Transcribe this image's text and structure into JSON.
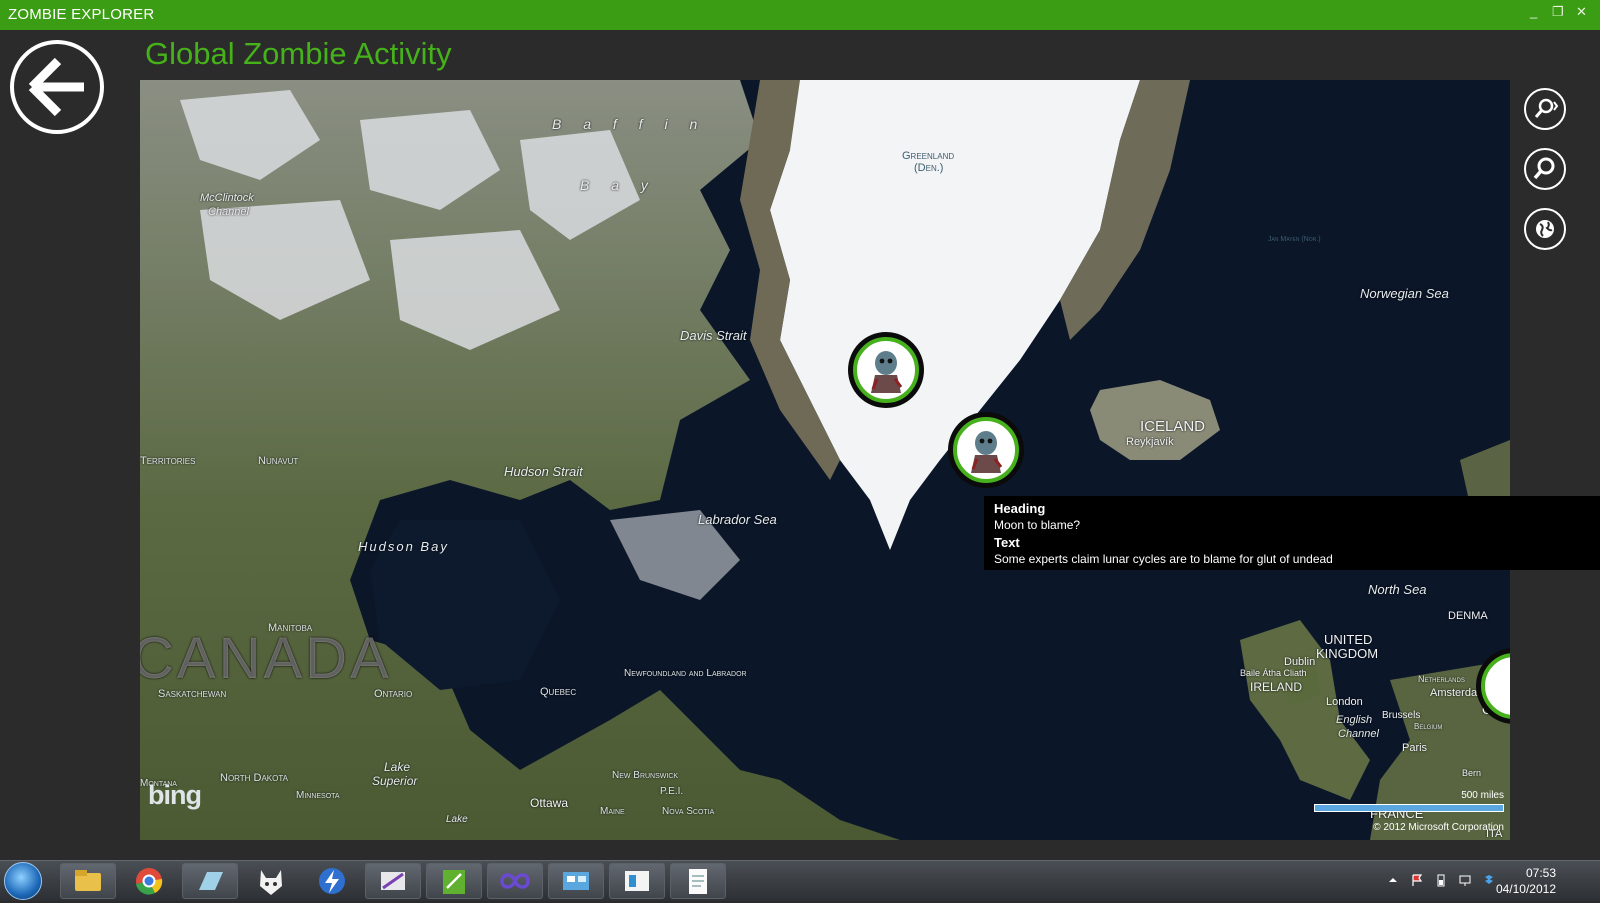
{
  "window": {
    "title": "ZOMBIE EXPLORER",
    "minimize": "_",
    "restore": "❐",
    "close": "✕"
  },
  "page": {
    "title": "Global Zombie Activity"
  },
  "map": {
    "labels": {
      "baffin_bay_1": "B a f f i n",
      "baffin_bay_2": "B a y",
      "mcclintock_1": "McClintock",
      "mcclintock_2": "Channel",
      "greenland_1": "Greenland",
      "greenland_2": "(Den.)",
      "davis_strait": "Davis Strait",
      "hudson_strait": "Hudson Strait",
      "labrador_sea": "Labrador Sea",
      "hudson_bay": "Hudson Bay",
      "territories": "Territories",
      "nunavut": "Nunavut",
      "manitoba": "Manitoba",
      "canada": "CANADA",
      "saskatchewan": "Saskatchewan",
      "ontario": "Ontario",
      "quebec": "Quebec",
      "newfoundland": "Newfoundland and Labrador",
      "lake_superior_1": "Lake",
      "lake_superior_2": "Superior",
      "north_dakota": "North Dakota",
      "montana": "Montana",
      "minnesota": "Minnesota",
      "new_brunswick": "New Brunswick",
      "pei": "P.E.I.",
      "ottawa": "Ottawa",
      "maine": "Maine",
      "nova_scotia": "Nova Scotia",
      "lake": "Lake",
      "iceland": "ICELAND",
      "reykjavik": "Reykjavík",
      "norwegian_sea": "Norwegian Sea",
      "north_sea": "North Sea",
      "united_kingdom_1": "UNITED",
      "united_kingdom_2": "KINGDOM",
      "dublin": "Dublin",
      "baile_atha_cliath": "Baile Átha Cliath",
      "ireland": "IRELAND",
      "london": "London",
      "english_channel_1": "English",
      "english_channel_2": "Channel",
      "brussels": "Brussels",
      "belgium": "Belgium",
      "netherlands": "Netherlands",
      "amsterdam": "Amsterdam",
      "paris": "Paris",
      "france": "FRANCE",
      "denmark": "DENMA",
      "germany": "GER",
      "bern": "Bern",
      "jan_mayen": "Jan Mayen (Nor.)",
      "italy": "ITA"
    },
    "scale_label": "500 miles",
    "copyright": "© 2012 Microsoft Corporation",
    "brand": "bing"
  },
  "tooltip": {
    "heading_label": "Heading",
    "heading_value": "Moon to blame?",
    "text_label": "Text",
    "text_value": "Some experts claim lunar cycles are to blame for glut of undead"
  },
  "map_tools": [
    "search-icon",
    "zoom-icon",
    "globe-icon"
  ],
  "taskbar": {
    "apps": [
      "file-explorer-icon",
      "chrome-icon",
      "app-icon",
      "fox-icon",
      "lightning-icon",
      "visual-studio-icon",
      "excel-icon",
      "infinity-icon",
      "control-panel-icon",
      "reader-icon",
      "notepad-icon"
    ],
    "time": "07:53",
    "date": "04/10/2012"
  },
  "colors": {
    "accent": "#3a9d13",
    "title_green": "#45b21a",
    "marker_ring": "#47b01d"
  }
}
